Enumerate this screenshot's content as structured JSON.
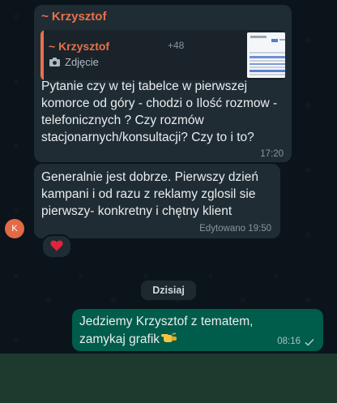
{
  "messages": [
    {
      "sender": "~ Krzysztof",
      "quote": {
        "sender": "~ Krzysztof",
        "number": "+48",
        "type_label": "Zdjęcie"
      },
      "text": "Pytanie czy w tej tabelce w pierwszej komorce od góry - chodzi o Ilość rozmow - telefonicznych ? Czy rozmów stacjonarnych/konsultacji? Czy to i to?",
      "time": "17:20"
    },
    {
      "text": "Generalnie jest dobrze. Pierwszy dzień kampani i od razu z reklamy zglosil sie pierwszy- konkretny i chętny klient",
      "time": "Edytowano 19:50",
      "avatar_initial": "K",
      "reaction": "heart"
    }
  ],
  "date_divider": "Dzisiaj",
  "outgoing": {
    "text": "Jedziemy Krzysztof z tematem, zamykaj grafik",
    "time": "08:16",
    "emoji": "pointing-hand",
    "status": "sent-single-tick"
  },
  "colors": {
    "chat_bg": "#0b141a",
    "incoming_bubble": "#202c33",
    "outgoing_bubble": "#005c4b",
    "sender_name": "#e8704d",
    "composer_area": "#1e3a2e"
  }
}
